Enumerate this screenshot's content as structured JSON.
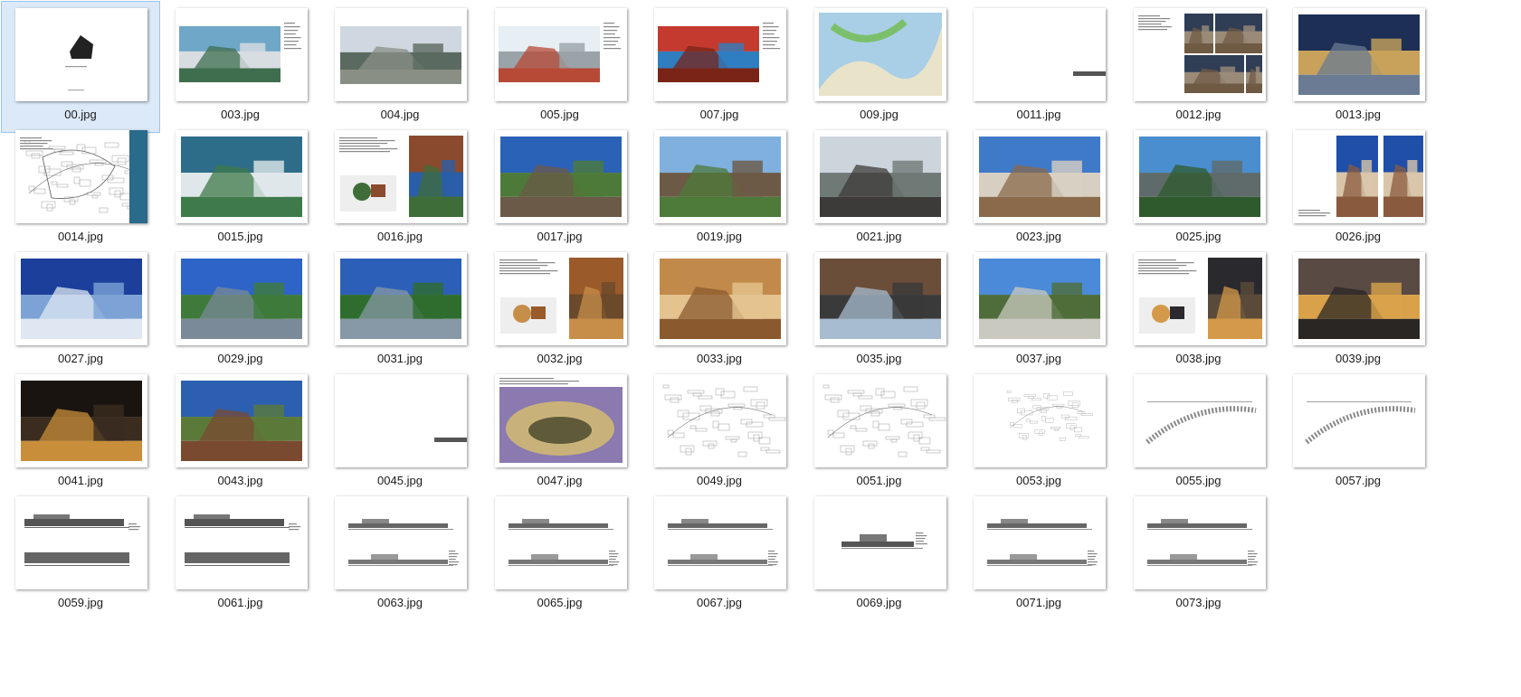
{
  "files": [
    {
      "name": "00.jpg",
      "kind": "cover",
      "selected": true
    },
    {
      "name": "003.jpg",
      "kind": "photo-text",
      "colors": [
        "#6fa7c8",
        "#3f6e4e",
        "#d8dde2"
      ]
    },
    {
      "name": "004.jpg",
      "kind": "photo-wide",
      "colors": [
        "#cfd8e0",
        "#8a8f86",
        "#5b6a60"
      ]
    },
    {
      "name": "005.jpg",
      "kind": "photo-text",
      "colors": [
        "#e7eef4",
        "#b74a36",
        "#9aa3a8"
      ]
    },
    {
      "name": "007.jpg",
      "kind": "photo-text",
      "colors": [
        "#c43a2e",
        "#7a2418",
        "#2f7ec0"
      ]
    },
    {
      "name": "009.jpg",
      "kind": "plan-color",
      "colors": [
        "#a8cfe6",
        "#7cbf6a",
        "#e9e3c9"
      ]
    },
    {
      "name": "0011.jpg",
      "kind": "blank-bar"
    },
    {
      "name": "0012.jpg",
      "kind": "text-collage",
      "colors": [
        "#2f3d55",
        "#6f5a44",
        "#9a8b78"
      ]
    },
    {
      "name": "0013.jpg",
      "kind": "photo",
      "colors": [
        "#1d2f55",
        "#6a7b93",
        "#c8a25a"
      ]
    },
    {
      "name": "0014.jpg",
      "kind": "text-sketch",
      "colors": [
        "#ffffff",
        "#555555",
        "#2a6a8a"
      ]
    },
    {
      "name": "0015.jpg",
      "kind": "photo",
      "colors": [
        "#2e6d8a",
        "#3f7a4a",
        "#dfe7ea"
      ]
    },
    {
      "name": "0016.jpg",
      "kind": "text-plan-photo",
      "colors": [
        "#8a4a2e",
        "#3f6d3a",
        "#2b5ea8"
      ]
    },
    {
      "name": "0017.jpg",
      "kind": "photo",
      "colors": [
        "#2a62b8",
        "#6b5a48",
        "#4d7a3a"
      ]
    },
    {
      "name": "0019.jpg",
      "kind": "photo",
      "colors": [
        "#7fb0de",
        "#4e7a3a",
        "#6d5a46"
      ]
    },
    {
      "name": "0021.jpg",
      "kind": "photo",
      "colors": [
        "#cdd5dc",
        "#3d3b39",
        "#6f7a77"
      ]
    },
    {
      "name": "0023.jpg",
      "kind": "photo",
      "colors": [
        "#3f7ac9",
        "#8a6a4a",
        "#d8cfc3"
      ]
    },
    {
      "name": "0025.jpg",
      "kind": "photo",
      "colors": [
        "#4a8ed0",
        "#2f5a2e",
        "#5e6b6a"
      ]
    },
    {
      "name": "0026.jpg",
      "kind": "text-photo",
      "colors": [
        "#1f4fa8",
        "#8a5a3e",
        "#d9c6aa"
      ]
    },
    {
      "name": "0027.jpg",
      "kind": "photo",
      "colors": [
        "#1b3f9a",
        "#dfe8f2",
        "#7ca2d6"
      ]
    },
    {
      "name": "0029.jpg",
      "kind": "photo",
      "colors": [
        "#2e63c8",
        "#7a8a98",
        "#3f7a3a"
      ]
    },
    {
      "name": "0031.jpg",
      "kind": "photo",
      "colors": [
        "#2c5fb8",
        "#8798a6",
        "#2f6d2e"
      ]
    },
    {
      "name": "0032.jpg",
      "kind": "text-plan-photo",
      "colors": [
        "#9a5a2a",
        "#c78e4a",
        "#6a4a2a"
      ]
    },
    {
      "name": "0033.jpg",
      "kind": "photo",
      "colors": [
        "#c28a4a",
        "#8a5a2e",
        "#e4c38e"
      ]
    },
    {
      "name": "0035.jpg",
      "kind": "photo",
      "colors": [
        "#6b4e3a",
        "#a7bcd0",
        "#3a3a3a"
      ]
    },
    {
      "name": "0037.jpg",
      "kind": "photo",
      "colors": [
        "#4a8ad8",
        "#c9c9c0",
        "#4f6d3a"
      ]
    },
    {
      "name": "0038.jpg",
      "kind": "text-plan-photo",
      "colors": [
        "#2a2a2e",
        "#d49a4a",
        "#5a4a3a"
      ]
    },
    {
      "name": "0039.jpg",
      "kind": "photo",
      "colors": [
        "#5a4a44",
        "#2a2624",
        "#d9a24a"
      ]
    },
    {
      "name": "0041.jpg",
      "kind": "photo",
      "colors": [
        "#1a1410",
        "#c88e3a",
        "#3a2c1f"
      ]
    },
    {
      "name": "0043.jpg",
      "kind": "photo",
      "colors": [
        "#2d5fb0",
        "#7a4a30",
        "#5b7a3a"
      ]
    },
    {
      "name": "0045.jpg",
      "kind": "blank-bar"
    },
    {
      "name": "0047.jpg",
      "kind": "render",
      "colors": [
        "#8a7ab0",
        "#c9b27a",
        "#5e5a3a"
      ]
    },
    {
      "name": "0049.jpg",
      "kind": "lineplan"
    },
    {
      "name": "0051.jpg",
      "kind": "lineplan"
    },
    {
      "name": "0053.jpg",
      "kind": "lineplan-small"
    },
    {
      "name": "0055.jpg",
      "kind": "lineplan-strip"
    },
    {
      "name": "0057.jpg",
      "kind": "lineplan-strip"
    },
    {
      "name": "0059.jpg",
      "kind": "elevation-dark"
    },
    {
      "name": "0061.jpg",
      "kind": "elevation-dark"
    },
    {
      "name": "0063.jpg",
      "kind": "elevation"
    },
    {
      "name": "0065.jpg",
      "kind": "elevation"
    },
    {
      "name": "0067.jpg",
      "kind": "elevation"
    },
    {
      "name": "0069.jpg",
      "kind": "elevation-single"
    },
    {
      "name": "0071.jpg",
      "kind": "elevation"
    },
    {
      "name": "0073.jpg",
      "kind": "elevation"
    }
  ]
}
